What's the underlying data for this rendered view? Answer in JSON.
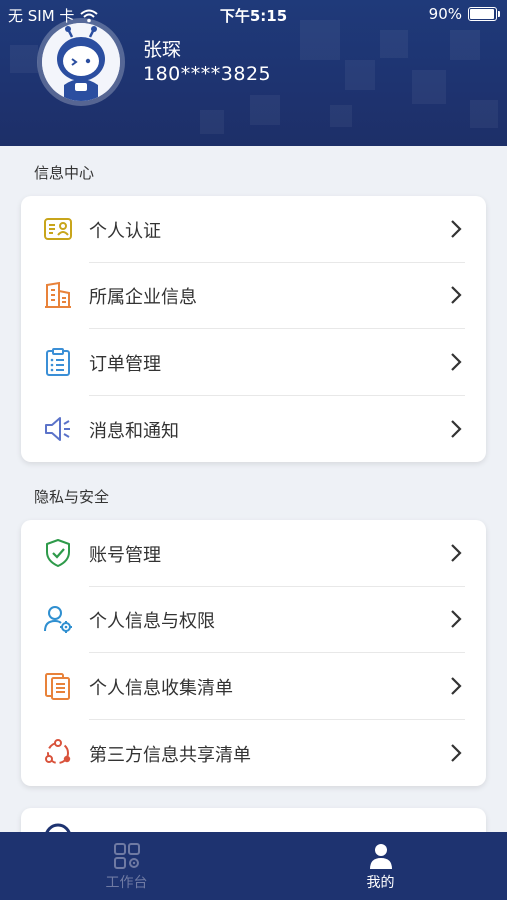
{
  "status_bar": {
    "carrier": "无 SIM 卡",
    "time": "下午5:15",
    "battery": "90%",
    "battery_level": 0.9
  },
  "profile": {
    "name": "张琛",
    "phone": "180****3825"
  },
  "sections": [
    {
      "title": "信息中心",
      "items": [
        {
          "label": "个人认证",
          "icon": "id-card-icon"
        },
        {
          "label": "所属企业信息",
          "icon": "building-icon"
        },
        {
          "label": "订单管理",
          "icon": "clipboard-list-icon"
        },
        {
          "label": "消息和通知",
          "icon": "megaphone-icon"
        }
      ]
    },
    {
      "title": "隐私与安全",
      "items": [
        {
          "label": "账号管理",
          "icon": "shield-check-icon"
        },
        {
          "label": "个人信息与权限",
          "icon": "user-settings-icon"
        },
        {
          "label": "个人信息收集清单",
          "icon": "documents-icon"
        },
        {
          "label": "第三方信息共享清单",
          "icon": "share-network-icon"
        }
      ]
    }
  ],
  "tabbar": {
    "workbench_label": "工作台",
    "mine_label": "我的"
  },
  "colors": {
    "header_bg": "#1e3370",
    "tabbar_bg": "#1e3370",
    "tab_active": "#ffffff",
    "tab_inactive": "#6f7aa3"
  }
}
